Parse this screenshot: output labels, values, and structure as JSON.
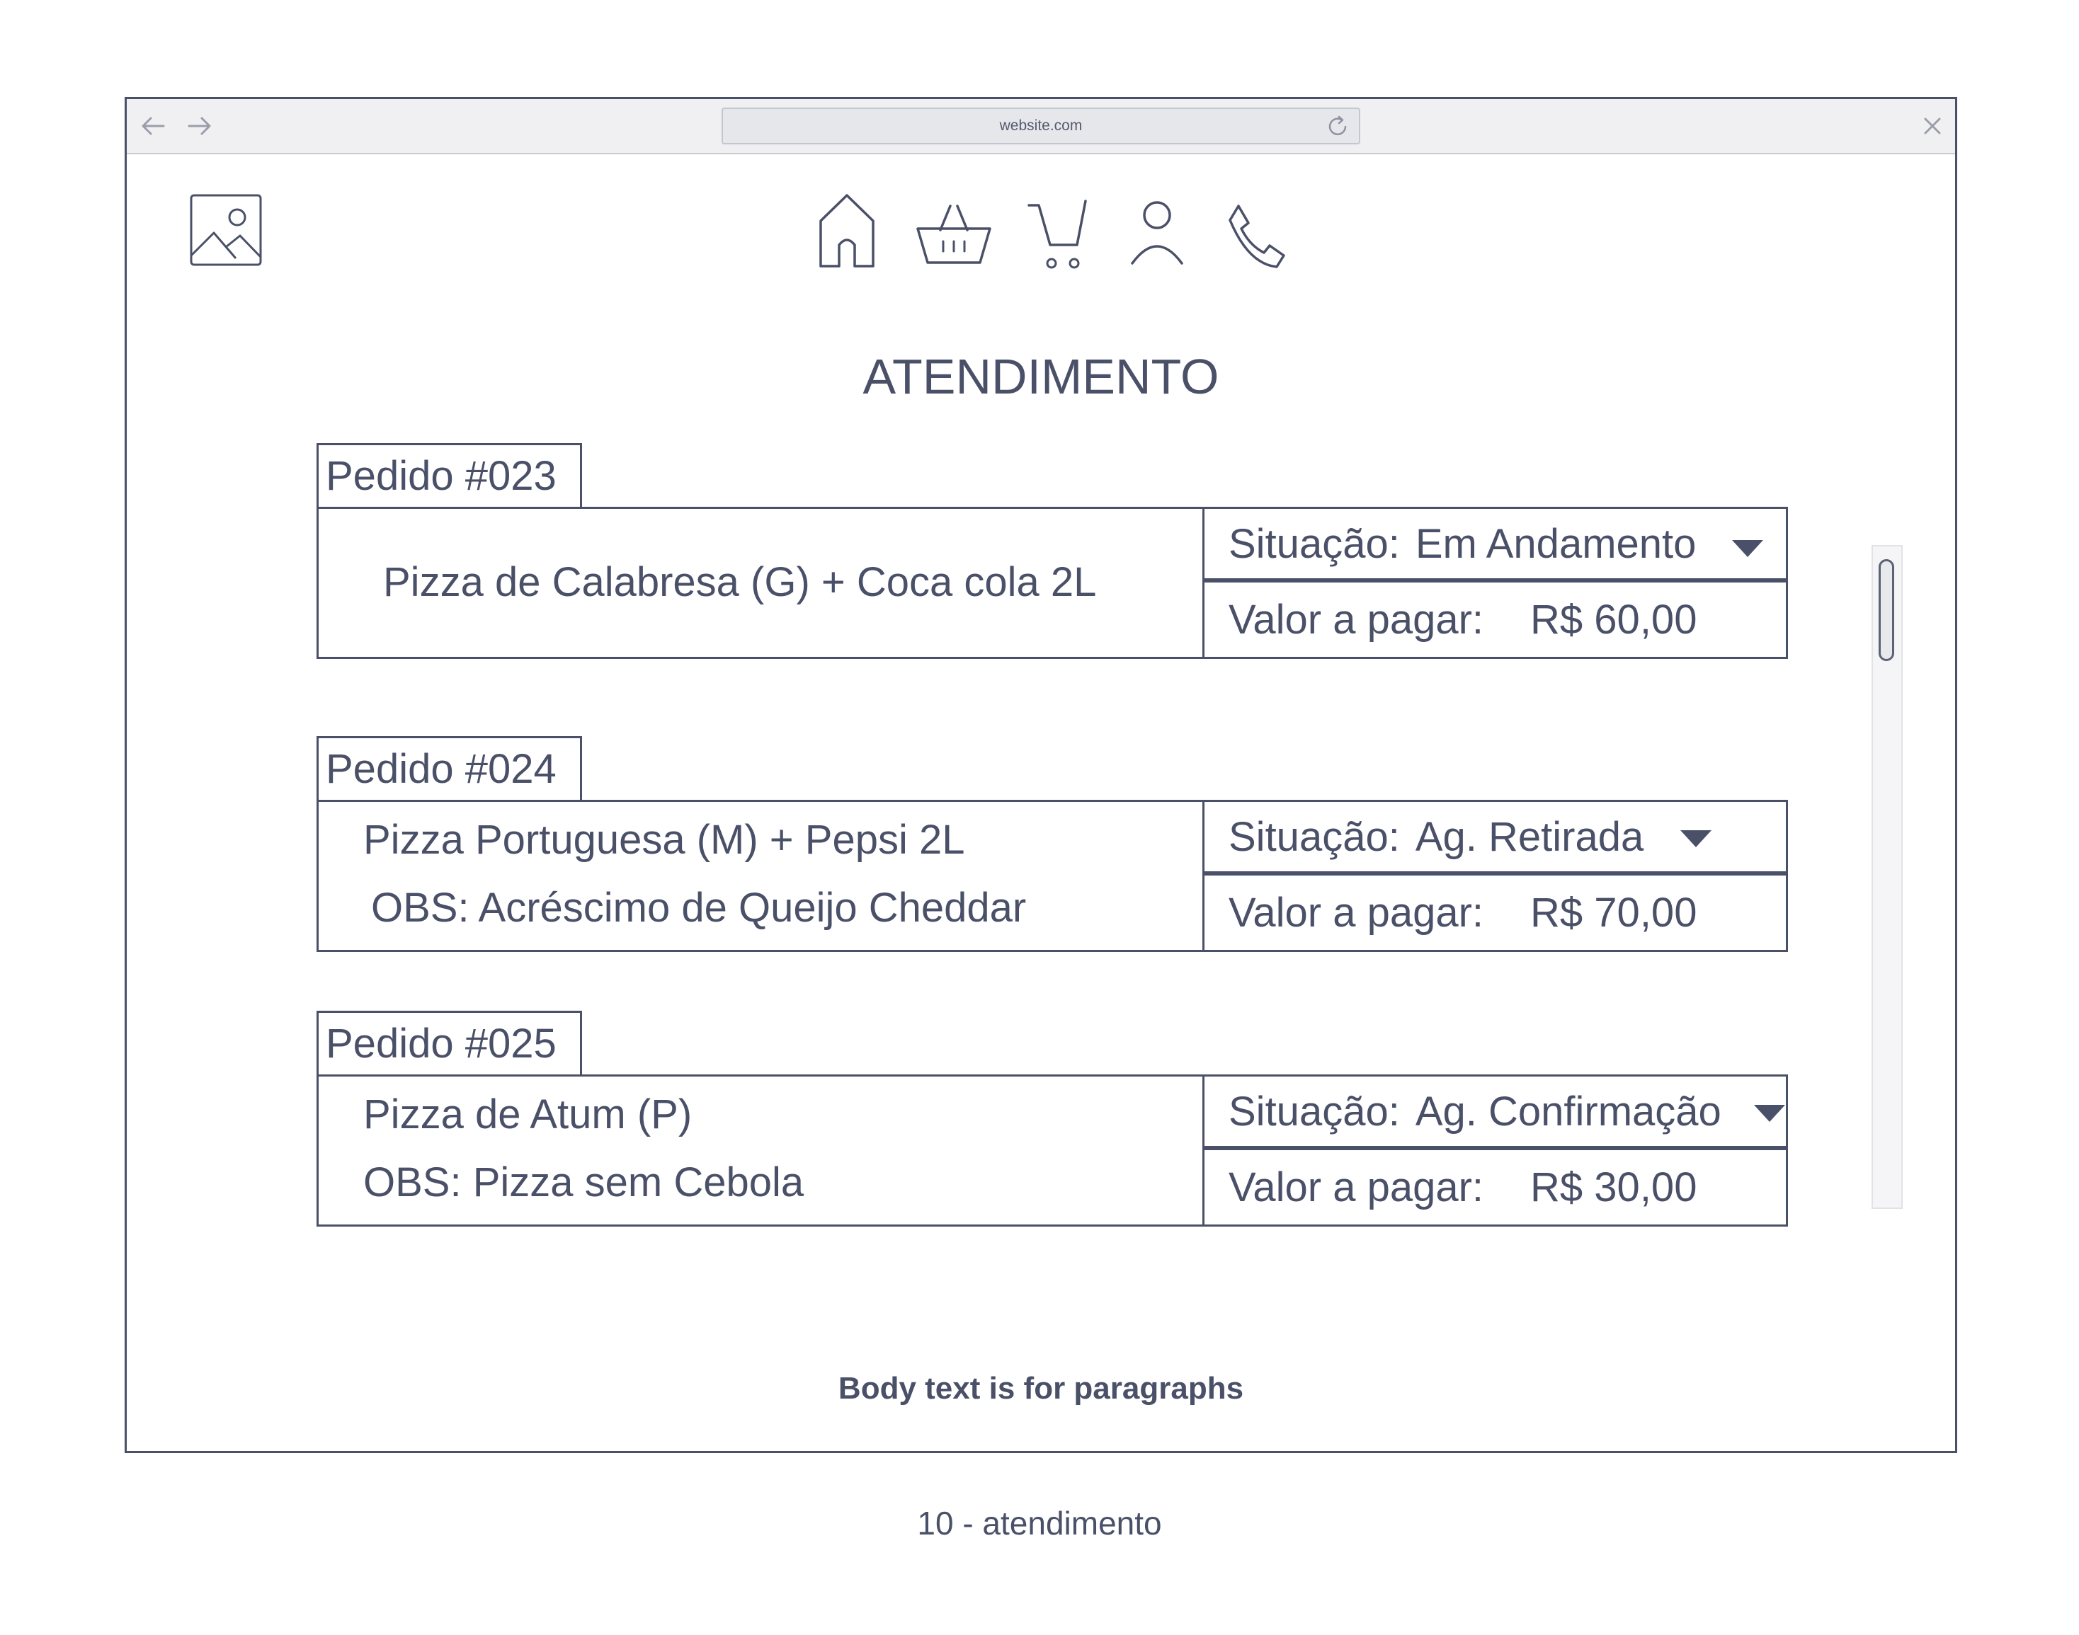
{
  "browser": {
    "url": "website.com",
    "back_icon": "arrow-left-icon",
    "forward_icon": "arrow-right-icon",
    "reload_icon": "reload-icon",
    "close_icon": "close-icon"
  },
  "header": {
    "logo_icon": "image-placeholder-icon",
    "nav": [
      "home-icon",
      "basket-icon",
      "cart-icon",
      "user-icon",
      "phone-icon"
    ]
  },
  "page": {
    "title": "ATENDIMENTO"
  },
  "orders": [
    {
      "label": "Pedido #023",
      "line1": "Pizza de Calabresa (G) + Coca cola 2L",
      "line2": "",
      "status_label": "Situação:",
      "status_value": "Em Andamento",
      "price_label": "Valor a pagar:",
      "price_value": "R$ 60,00"
    },
    {
      "label": "Pedido #024",
      "line1": "Pizza Portuguesa (M) + Pepsi 2L",
      "line2": "OBS: Acréscimo de Queijo Cheddar",
      "status_label": "Situação:",
      "status_value": "Ag. Retirada",
      "price_label": "Valor a pagar:",
      "price_value": "R$ 70,00"
    },
    {
      "label": "Pedido #025",
      "line1": "Pizza de Atum (P)",
      "line2": "OBS: Pizza sem Cebola",
      "status_label": "Situação:",
      "status_value": "Ag. Confirmação",
      "price_label": "Valor a pagar:",
      "price_value": "R$ 30,00"
    }
  ],
  "footer": {
    "body_text": "Body text is for paragraphs"
  },
  "caption": "10 - atendimento",
  "colors": {
    "ink": "#4a5068",
    "topbar": "#f0f0f2",
    "address_bar": "#e6e7ea"
  }
}
